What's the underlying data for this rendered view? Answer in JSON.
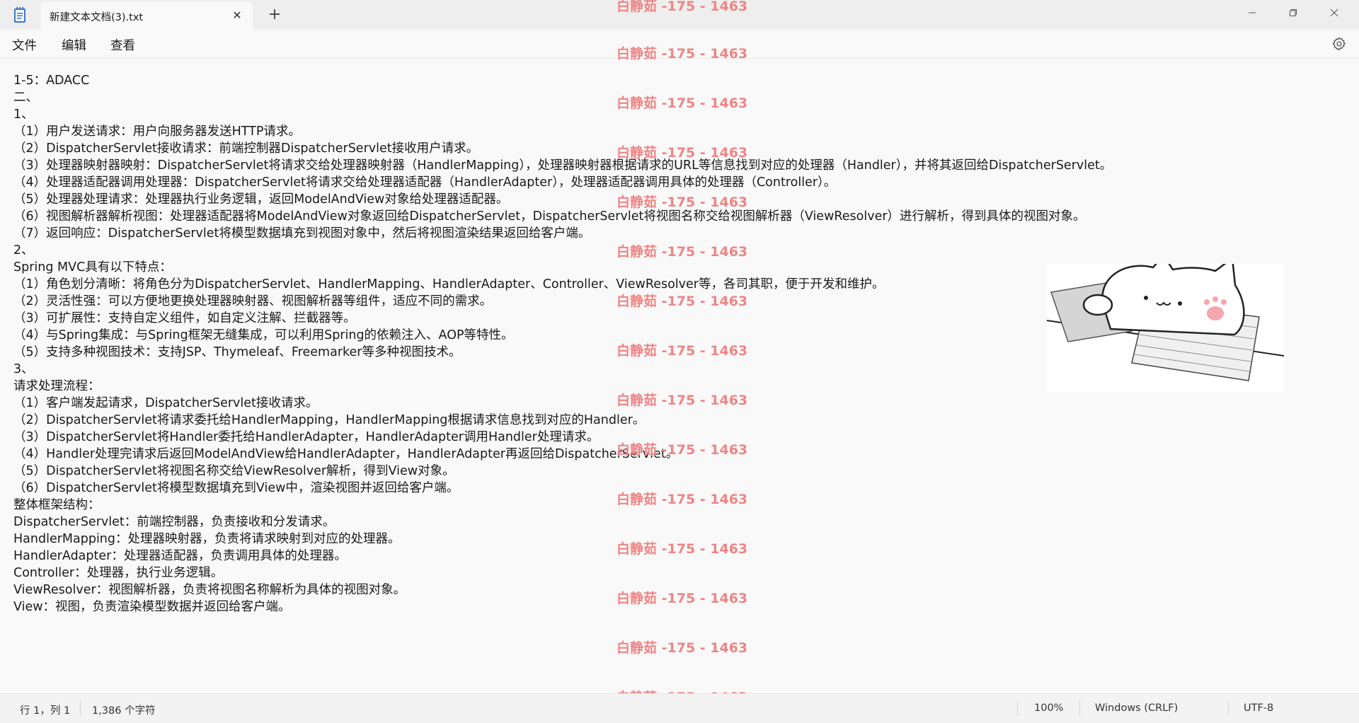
{
  "tab": {
    "title": "新建文本文档(3).txt"
  },
  "icons": {
    "app": "notepad-icon",
    "close_tab": "close-icon",
    "new_tab": "plus-icon",
    "settings": "gear-icon"
  },
  "menu": {
    "file": "文件",
    "edit": "编辑",
    "view": "查看"
  },
  "editor": {
    "lines": [
      "1-5：ADACC",
      "二、",
      "1、",
      "（1）用户发送请求：用户向服务器发送HTTP请求。",
      "（2）DispatcherServlet接收请求：前端控制器DispatcherServlet接收用户请求。",
      "（3）处理器映射器映射：DispatcherServlet将请求交给处理器映射器（HandlerMapping），处理器映射器根据请求的URL等信息找到对应的处理器（Handler），并将其返回给DispatcherServlet。",
      "（4）处理器适配器调用处理器：DispatcherServlet将请求交给处理器适配器（HandlerAdapter），处理器适配器调用具体的处理器（Controller）。",
      "（5）处理器处理请求：处理器执行业务逻辑，返回ModelAndView对象给处理器适配器。",
      "（6）视图解析器解析视图：处理器适配器将ModelAndView对象返回给DispatcherServlet，DispatcherServlet将视图名称交给视图解析器（ViewResolver）进行解析，得到具体的视图对象。",
      "（7）返回响应：DispatcherServlet将模型数据填充到视图对象中，然后将视图渲染结果返回给客户端。",
      "2、",
      "Spring MVC具有以下特点：",
      "（1）角色划分清晰：将角色分为DispatcherServlet、HandlerMapping、HandlerAdapter、Controller、ViewResolver等，各司其职，便于开发和维护。",
      "（2）灵活性强：可以方便地更换处理器映射器、视图解析器等组件，适应不同的需求。",
      "（3）可扩展性：支持自定义组件，如自定义注解、拦截器等。",
      "（4）与Spring集成：与Spring框架无缝集成，可以利用Spring的依赖注入、AOP等特性。",
      "（5）支持多种视图技术：支持JSP、Thymeleaf、Freemarker等多种视图技术。",
      "3、",
      "请求处理流程：",
      "（1）客户端发起请求，DispatcherServlet接收请求。",
      "（2）DispatcherServlet将请求委托给HandlerMapping，HandlerMapping根据请求信息找到对应的Handler。",
      "（3）DispatcherServlet将Handler委托给HandlerAdapter，HandlerAdapter调用Handler处理请求。",
      "（4）Handler处理完请求后返回ModelAndView给HandlerAdapter，HandlerAdapter再返回给DispatcherServlet。",
      "（5）DispatcherServlet将视图名称交给ViewResolver解析，得到View对象。",
      "（6）DispatcherServlet将模型数据填充到View中，渲染视图并返回给客户端。",
      "整体框架结构：",
      "DispatcherServlet：前端控制器，负责接收和分发请求。",
      "HandlerMapping：处理器映射器，负责将请求映射到对应的处理器。",
      "HandlerAdapter：处理器适配器，负责调用具体的处理器。",
      "Controller：处理器，执行业务逻辑。",
      "ViewResolver：视图解析器，负责将视图名称解析为具体的视图对象。",
      "View：视图，负责渲染模型数据并返回给客户端。"
    ]
  },
  "watermark": {
    "text": "白静茹 -175 - 1463",
    "color": "#ef8585"
  },
  "status": {
    "position": "行 1，列 1",
    "chars": "1,386 个字符",
    "zoom": "100%",
    "line_ending": "Windows (CRLF)",
    "encoding": "UTF-8"
  }
}
